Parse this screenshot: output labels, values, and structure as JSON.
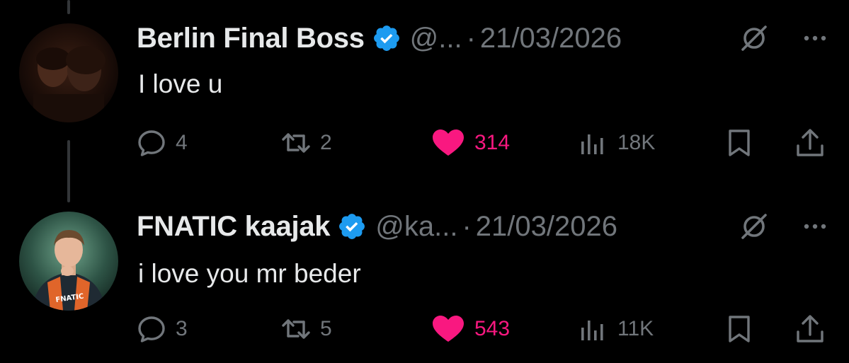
{
  "colors": {
    "background": "#000000",
    "text_primary": "#e7e9ea",
    "text_secondary": "#71767b",
    "verified": "#1d9bf0",
    "like": "#f91880",
    "thread_line": "#333639"
  },
  "tweets": [
    {
      "display_name": "Berlin Final Boss",
      "handle": "@...",
      "separator": "·",
      "date": "21/03/2026",
      "text": "I love u",
      "verified": true,
      "stats": {
        "replies": "4",
        "reposts": "2",
        "likes": "314",
        "views": "18K"
      },
      "liked": true,
      "icons": [
        "reply-icon",
        "repost-icon",
        "heart-filled-icon",
        "views-icon",
        "bookmark-icon",
        "share-icon",
        "grok-icon",
        "more-icon"
      ]
    },
    {
      "display_name": "FNATIC kaajak",
      "handle": "@ka...",
      "separator": "·",
      "date": "21/03/2026",
      "text": "i love you mr beder",
      "verified": true,
      "stats": {
        "replies": "3",
        "reposts": "5",
        "likes": "543",
        "views": "11K"
      },
      "liked": true,
      "avatar_logo_text": "FNATIC",
      "icons": [
        "reply-icon",
        "repost-icon",
        "heart-filled-icon",
        "views-icon",
        "bookmark-icon",
        "share-icon",
        "grok-icon",
        "more-icon"
      ]
    }
  ]
}
